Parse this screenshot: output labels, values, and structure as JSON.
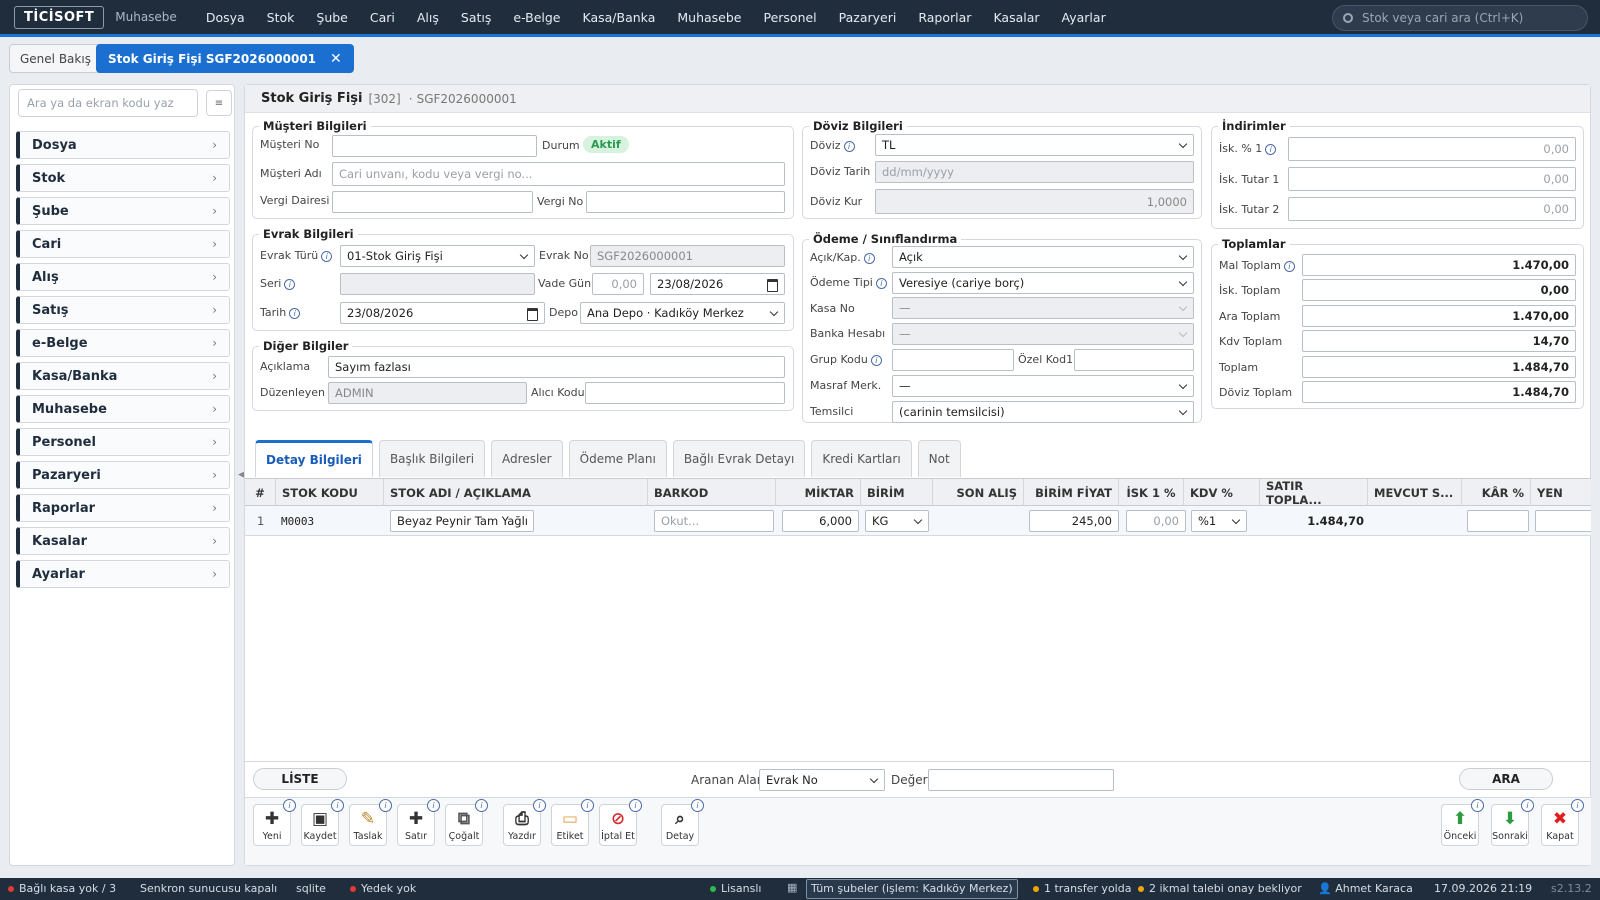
{
  "app": {
    "logo": "TİCİSOFT",
    "module": "Muhasebe"
  },
  "menu": [
    "Dosya",
    "Stok",
    "Şube",
    "Cari",
    "Alış",
    "Satış",
    "e-Belge",
    "Kasa/Banka",
    "Muhasebe",
    "Personel",
    "Pazaryeri",
    "Raporlar",
    "Kasalar",
    "Ayarlar"
  ],
  "search": {
    "placeholder": "Stok veya cari ara (Ctrl+K)"
  },
  "tabs": {
    "general": "Genel Bakış",
    "active": "Stok Giriş Fişi SGF2026000001",
    "close": "✕"
  },
  "sidebar": {
    "search_placeholder": "Ara ya da ekran kodu yaz",
    "btn": "≡",
    "items": [
      "Dosya",
      "Stok",
      "Şube",
      "Cari",
      "Alış",
      "Satış",
      "e-Belge",
      "Kasa/Banka",
      "Muhasebe",
      "Personel",
      "Pazaryeri",
      "Raporlar",
      "Kasalar",
      "Ayarlar"
    ]
  },
  "header": {
    "title": "Stok Giriş Fişi",
    "code": "[302]",
    "sep": "·",
    "doc_no": "SGF2026000001"
  },
  "musteri": {
    "legend": "Müşteri Bilgileri",
    "no_label": "Müşteri No",
    "no_value": "",
    "durum_label": "Durum",
    "durum_value": "Aktif",
    "adi_label": "Müşteri Adı",
    "adi_placeholder": "Cari unvanı, kodu veya vergi no...",
    "vd_label": "Vergi Dairesi",
    "vd_value": "",
    "vno_label": "Vergi No",
    "vno_value": ""
  },
  "evrak": {
    "legend": "Evrak Bilgileri",
    "tur_label": "Evrak Türü",
    "tur_value": "01-Stok Giriş Fişi",
    "no_label": "Evrak No",
    "no_value": "SGF2026000001",
    "seri_label": "Seri",
    "seri_value": "",
    "vade_label": "Vade Gün",
    "vade_value": "0,00",
    "vade_date": "23/08/2026",
    "tarih_label": "Tarih",
    "tarih_value": "23/08/2026",
    "depo_label": "Depo",
    "depo_value": "Ana Depo · Kadıköy Merkez"
  },
  "diger": {
    "legend": "Diğer Bilgiler",
    "aciklama_label": "Açıklama",
    "aciklama_value": "Sayım fazlası",
    "duzenleyen_label": "Düzenleyen",
    "duzenleyen_value": "ADMIN",
    "alici_label": "Alıcı Kodu",
    "alici_value": ""
  },
  "doviz": {
    "legend": "Döviz Bilgileri",
    "doviz_label": "Döviz",
    "doviz_value": "TL",
    "tarih_label": "Döviz Tarih",
    "tarih_placeholder": "dd/mm/yyyy",
    "kur_label": "Döviz Kur",
    "kur_value": "1,0000"
  },
  "odeme": {
    "legend": "Ödeme / Sınıflandırma",
    "acik_label": "Açık/Kap.",
    "acik_value": "Açık",
    "tip_label": "Ödeme Tipi",
    "tip_value": "Veresiye (cariye borç)",
    "kasa_label": "Kasa No",
    "kasa_value": "—",
    "banka_label": "Banka Hesabı",
    "banka_value": "—",
    "grup_label": "Grup Kodu",
    "grup_value": "",
    "ozel_label": "Özel Kod1",
    "ozel_value": "",
    "masraf_label": "Masraf Merk.",
    "masraf_value": "—",
    "temsilci_label": "Temsilci",
    "temsilci_value": "(carinin temsilcisi)"
  },
  "indirimler": {
    "legend": "İndirimler",
    "isk1_label": "İsk. % 1",
    "isk1_value": "0,00",
    "tutar1_label": "İsk. Tutar 1",
    "tutar1_value": "0,00",
    "tutar2_label": "İsk. Tutar 2",
    "tutar2_value": "0,00"
  },
  "toplamlar": {
    "legend": "Toplamlar",
    "mal_label": "Mal Toplam",
    "mal_value": "1.470,00",
    "isk_label": "İsk. Toplam",
    "isk_value": "0,00",
    "ara_label": "Ara Toplam",
    "ara_value": "1.470,00",
    "kdv_label": "Kdv Toplam",
    "kdv_value": "14,70",
    "toplam_label": "Toplam",
    "toplam_value": "1.484,70",
    "doviz_label": "Döviz Toplam",
    "doviz_value": "1.484,70"
  },
  "detail_tabs": [
    "Detay Bilgileri",
    "Başlık Bilgileri",
    "Adresler",
    "Ödeme Planı",
    "Bağlı Evrak Detayı",
    "Kredi Kartları",
    "Not"
  ],
  "grid": {
    "headers": [
      "#",
      "STOK KODU",
      "STOK ADI / AÇIKLAMA",
      "BARKOD",
      "MİKTAR",
      "BİRİM",
      "SON ALIŞ",
      "BİRİM FİYAT",
      "İSK 1 %",
      "KDV %",
      "SATIR TOPLA...",
      "MEVCUT S...",
      "KÂR %",
      "YEN"
    ],
    "row": {
      "no": "1",
      "kod": "M0003",
      "adi": "Beyaz Peynir Tam Yağlı",
      "barkod_placeholder": "Okut...",
      "miktar": "6,000",
      "birim": "KG",
      "son_alis": "",
      "fiyat": "245,00",
      "isk": "0,00",
      "kdv": "%1",
      "toplam": "1.484,70",
      "mevcut": "",
      "kar": ""
    }
  },
  "bottom": {
    "liste": "LİSTE",
    "aranan_label": "Aranan Alan",
    "aranan_value": "Evrak No",
    "deger_label": "Değer",
    "deger_value": "",
    "ara": "ARA"
  },
  "toolbar": {
    "left": [
      {
        "label": "Yeni",
        "icon": "plus-icon",
        "glyph": "✚",
        "color": "#333"
      },
      {
        "label": "Kaydet",
        "icon": "save-icon",
        "glyph": "▣",
        "color": "#444"
      },
      {
        "label": "Taslak",
        "icon": "draft-icon",
        "glyph": "✎",
        "color": "#b8862b"
      },
      {
        "label": "Satır",
        "icon": "add-row-icon",
        "glyph": "✚",
        "color": "#333"
      },
      {
        "label": "Çoğalt",
        "icon": "copy-icon",
        "glyph": "⧉",
        "color": "#555"
      },
      {
        "label": "Yazdır",
        "icon": "print-icon",
        "glyph": "⎙",
        "color": "#444"
      },
      {
        "label": "Etiket",
        "icon": "label-icon",
        "glyph": "▭",
        "color": "#e0a050"
      },
      {
        "label": "İptal Et",
        "icon": "cancel-icon",
        "glyph": "⊘",
        "color": "#d32f2f"
      },
      {
        "label": "Detay",
        "icon": "detail-search-icon",
        "glyph": "⌕",
        "color": "#444"
      }
    ],
    "right": [
      {
        "label": "Önceki",
        "icon": "arrow-up-icon",
        "glyph": "⬆",
        "color": "#2e9b43"
      },
      {
        "label": "Sonraki",
        "icon": "arrow-down-icon",
        "glyph": "⬇",
        "color": "#2e9b43"
      },
      {
        "label": "Kapat",
        "icon": "close-red-icon",
        "glyph": "✖",
        "color": "#e02020"
      }
    ]
  },
  "statusbar": {
    "kasa": "Bağlı kasa yok / 3",
    "senkron": "Senkron sunucusu kapalı",
    "db": "sqlite",
    "yedek": "Yedek yok",
    "lisans": "Lisanslı",
    "sube": "Tüm şubeler (işlem: Kadıköy Merkez)",
    "transfer": "1 transfer yolda",
    "ikmal": "2 ikmal talebi onay bekliyor",
    "user": "Ahmet Karaca",
    "datetime": "17.09.2026 21:19",
    "version": "s2.13.2"
  },
  "colors": {
    "accent": "#1a6fd0",
    "topbar": "#1f2d3d",
    "status_green": "#2fb84f",
    "status_red": "#e53935",
    "status_amber": "#f0a500"
  }
}
